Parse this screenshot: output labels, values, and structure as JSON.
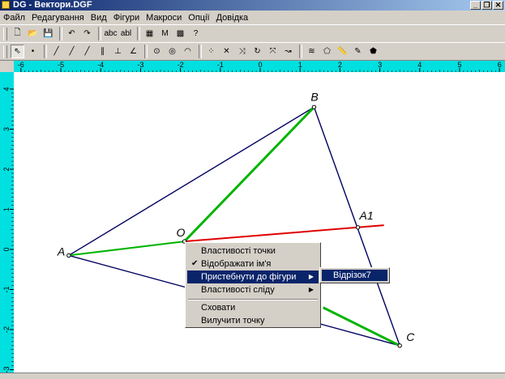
{
  "window": {
    "title": "DG - Вектори.DGF",
    "buttons": [
      "_",
      "❐",
      "✕"
    ]
  },
  "menubar": [
    "Файл",
    "Редагування",
    "Вид",
    "Фігури",
    "Макроси",
    "Опції",
    "Довідка"
  ],
  "toolbar1": [
    {
      "name": "new-file-icon",
      "glyph": "🗋"
    },
    {
      "name": "open-folder-icon",
      "glyph": "📂"
    },
    {
      "name": "save-icon",
      "glyph": "💾"
    },
    {
      "name": "undo-icon",
      "glyph": "↶"
    },
    {
      "name": "redo-icon",
      "glyph": "↷"
    },
    {
      "name": "label-abc-icon",
      "glyph": "abc"
    },
    {
      "name": "label-abl-icon",
      "glyph": "abl"
    },
    {
      "name": "calculator-icon",
      "glyph": "▦"
    },
    {
      "name": "macro-icon",
      "glyph": "M"
    },
    {
      "name": "color-grid-icon",
      "glyph": "▩"
    },
    {
      "name": "help-icon",
      "glyph": "?"
    }
  ],
  "toolbar2": [
    {
      "name": "pointer-tool-icon",
      "glyph": "⇖",
      "selected": true
    },
    {
      "name": "point-tool-icon",
      "glyph": "•"
    },
    {
      "name": "segment-tool-icon",
      "glyph": "╱"
    },
    {
      "name": "line-tool-icon",
      "glyph": "╱"
    },
    {
      "name": "ray-tool-icon",
      "glyph": "╱"
    },
    {
      "name": "parallel-tool-icon",
      "glyph": "∥"
    },
    {
      "name": "perpendicular-tool-icon",
      "glyph": "⊥"
    },
    {
      "name": "angle-bisector-tool-icon",
      "glyph": "∠"
    },
    {
      "name": "circle-tool-icon",
      "glyph": "⊙"
    },
    {
      "name": "circle-radius-tool-icon",
      "glyph": "◎"
    },
    {
      "name": "arc-tool-icon",
      "glyph": "◠"
    },
    {
      "name": "midpoint-tool-icon",
      "glyph": "⁘"
    },
    {
      "name": "intersection-tool-icon",
      "glyph": "✕"
    },
    {
      "name": "symmetry-tool-icon",
      "glyph": "⤨"
    },
    {
      "name": "rotation-tool-icon",
      "glyph": "↻"
    },
    {
      "name": "homothety-tool-icon",
      "glyph": "⤧"
    },
    {
      "name": "translation-tool-icon",
      "glyph": "↝"
    },
    {
      "name": "locus-tool-icon",
      "glyph": "≋"
    },
    {
      "name": "polygon-tool-icon",
      "glyph": "⬠"
    },
    {
      "name": "measure-tool-icon",
      "glyph": "📏"
    },
    {
      "name": "eraser-tool-icon",
      "glyph": "✎"
    },
    {
      "name": "fill-polygon-tool-icon",
      "glyph": "⬟"
    }
  ],
  "axes": {
    "x_ticks": [
      -6,
      -5,
      -4,
      -3,
      -2,
      -1,
      0,
      1,
      2,
      3,
      4,
      5,
      6
    ],
    "y_ticks": [
      4,
      3,
      2,
      1,
      0,
      -1,
      -2,
      -3
    ]
  },
  "points": [
    {
      "label": "A",
      "x": -4.8,
      "y": -0.15
    },
    {
      "label": "B",
      "x": 1.35,
      "y": 3.55
    },
    {
      "label": "C",
      "x": 3.5,
      "y": -2.4
    },
    {
      "label": "O",
      "x": -1.9,
      "y": 0.2
    },
    {
      "label": "A1",
      "x": 2.45,
      "y": 0.55
    }
  ],
  "colors": {
    "navy": "#000060",
    "green": "#00b400",
    "red": "#e00000",
    "grid_ruler": "#00e0e0"
  },
  "context_menu": {
    "items": [
      {
        "label": "Властивості точки"
      },
      {
        "label": "Відображати ім'я",
        "checked": true
      },
      {
        "label": "Пристебнути до фігури",
        "submenu": true,
        "highlighted": true
      },
      {
        "label": "Властивості сліду",
        "submenu": true
      },
      {
        "label": "Сховати"
      },
      {
        "label": "Вилучити точку"
      }
    ],
    "check_glyph": "✔",
    "arrow_glyph": "▶"
  },
  "submenu": {
    "label": "Відрізок7"
  }
}
